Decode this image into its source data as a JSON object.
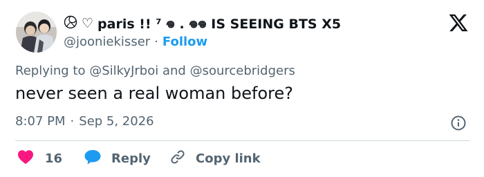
{
  "author": {
    "display_name": "paris !! ⁷ 𖦹 . 𖦹𖦹 IS SEEING BTS X5",
    "handle": "@jooniekisser",
    "follow_label": "Follow",
    "avatar_icon": "profile-photo"
  },
  "tweet": {
    "reply_prefix": "Replying to",
    "reply_to_1": "@SilkyJrboi",
    "reply_and": "and",
    "reply_to_2": "@sourcebridgers",
    "text": "never seen a real woman before?",
    "time": "8:07 PM",
    "date": "Sep 5, 2026"
  },
  "actions": {
    "like_count": "16",
    "reply_label": "Reply",
    "copy_label": "Copy link"
  },
  "colors": {
    "accent": "#1d9bf0",
    "like": "#f91880",
    "muted": "#536471",
    "text": "#0f1419",
    "divider": "#cfd9de"
  },
  "icons": {
    "brand": "x-logo-icon",
    "info": "info-icon",
    "like": "heart-icon",
    "reply": "speech-bubble-icon",
    "copy": "link-icon"
  }
}
